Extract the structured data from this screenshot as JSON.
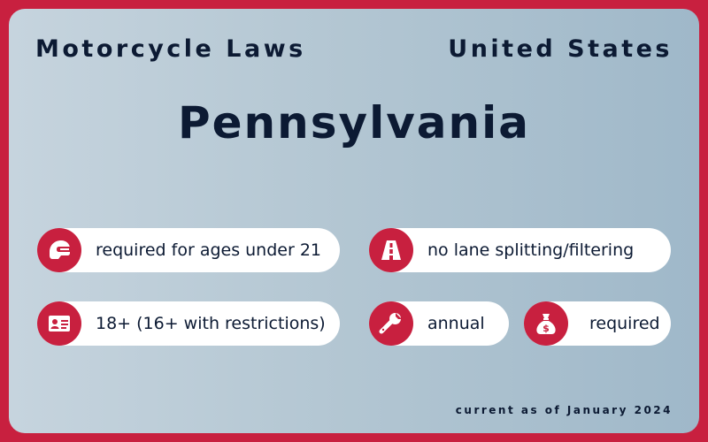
{
  "header": {
    "title": "Motorcycle Laws",
    "region": "United States"
  },
  "state": "Pennsylvania",
  "laws": {
    "helmet": {
      "icon": "helmet-icon",
      "text": "required for ages under 21"
    },
    "lane_splitting": {
      "icon": "road-icon",
      "text": "no lane splitting/filtering"
    },
    "license": {
      "icon": "id-card-icon",
      "text": "18+ (16+ with restrictions)"
    },
    "inspection": {
      "icon": "wrench-icon",
      "text": "annual"
    },
    "insurance": {
      "icon": "money-bag-icon",
      "text": "required"
    }
  },
  "footer": "current as of January 2024",
  "colors": {
    "accent": "#c8203f",
    "text": "#0c1a33",
    "pill": "#ffffff"
  }
}
